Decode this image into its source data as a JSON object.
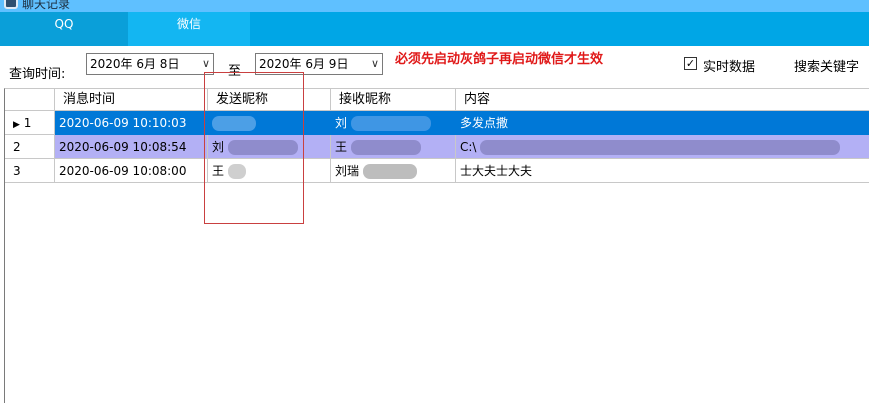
{
  "window": {
    "title": "聊天记录"
  },
  "tabs": [
    {
      "label": "QQ",
      "active": true
    },
    {
      "label": "微信",
      "active": false
    }
  ],
  "toolbar": {
    "query_time_label": "查询时间:",
    "start_date": "2020年 6月 8日",
    "to_label": "至",
    "end_date": "2020年 6月 9日",
    "warning": "必须先启动灰鸽子再启动微信才生效",
    "realtime_label": "实时数据",
    "realtime_checked": true,
    "search_label": "搜索关键字"
  },
  "grid": {
    "columns": [
      "消息时间",
      "发送昵称",
      "接收昵称",
      "内容"
    ],
    "rows": [
      {
        "index": "1",
        "time": "2020-06-09 10:10:03",
        "sender": "",
        "receiver": "刘",
        "content": "多发点撒",
        "selected": true
      },
      {
        "index": "2",
        "time": "2020-06-09 10:08:54",
        "sender": "刘",
        "receiver": "王",
        "content": "C:\\",
        "selected": false
      },
      {
        "index": "3",
        "time": "2020-06-09 10:08:00",
        "sender": "王",
        "receiver": "刘瑞",
        "content": "士大夫士大夫",
        "selected": false
      }
    ]
  },
  "colors": {
    "titlebar": "#5fc0ff",
    "tabstrip": "#00a6e6",
    "selection": "#0078d7",
    "alt_row": "#b3b0f5",
    "warning": "#e01818"
  }
}
